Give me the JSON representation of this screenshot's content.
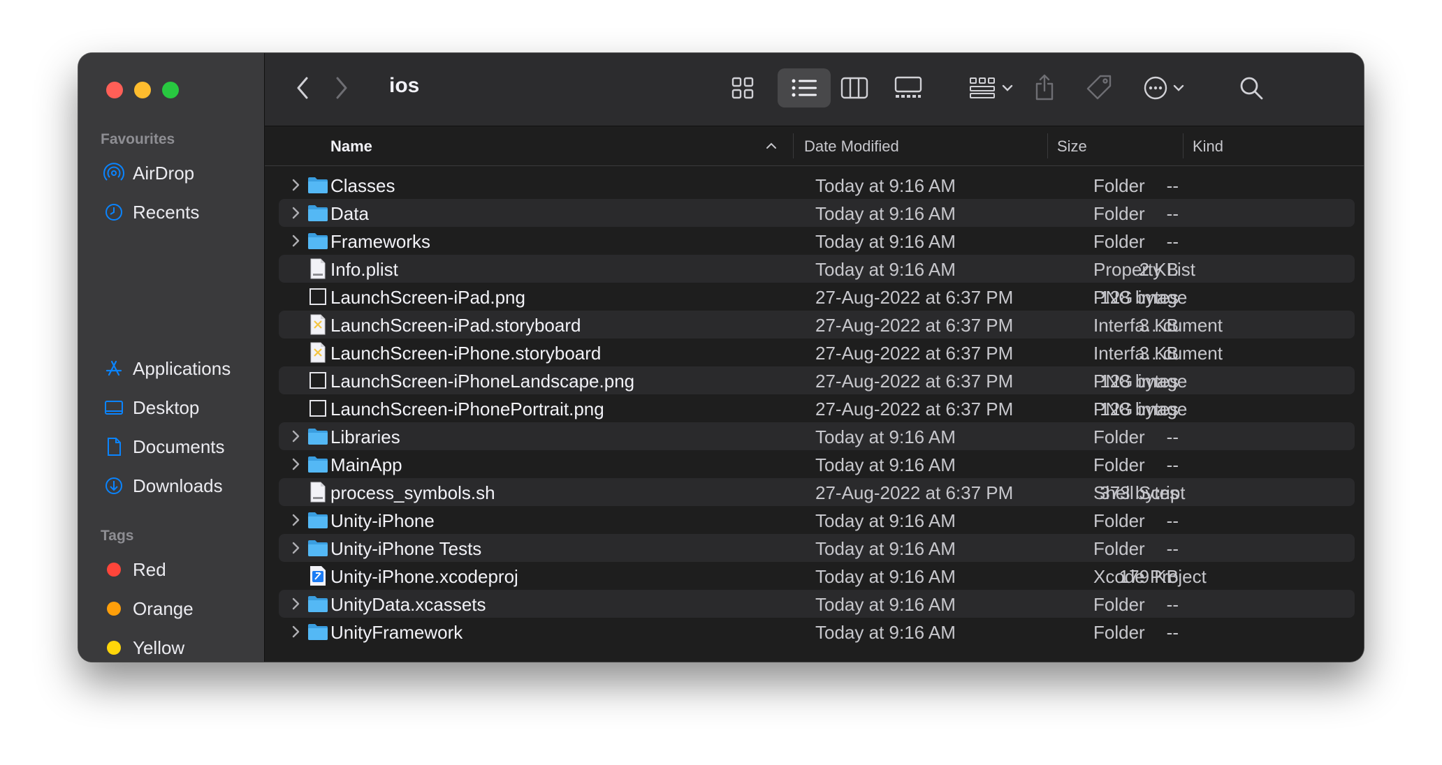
{
  "window": {
    "title": "ios",
    "colors": {
      "accent": "#0a84ff",
      "folder": "#54b8f5",
      "sidebar_bg": "#3a3a3c",
      "content_bg": "#1e1e1e"
    }
  },
  "sidebar": {
    "favourites_heading": "Favourites",
    "favourites": [
      {
        "label": "AirDrop",
        "icon": "airdrop-icon"
      },
      {
        "label": "Recents",
        "icon": "clock-icon"
      },
      {
        "label": "Applications",
        "icon": "applications-icon"
      },
      {
        "label": "Desktop",
        "icon": "desktop-icon"
      },
      {
        "label": "Documents",
        "icon": "document-icon"
      },
      {
        "label": "Downloads",
        "icon": "downloads-icon"
      }
    ],
    "tags_heading": "Tags",
    "tags": [
      {
        "label": "Red",
        "color": "#ff453a"
      },
      {
        "label": "Orange",
        "color": "#ff9f0a"
      },
      {
        "label": "Yellow",
        "color": "#ffd60a"
      }
    ]
  },
  "toolbar": {
    "icons": [
      "back-icon",
      "forward-icon",
      "icon-view-icon",
      "list-view-icon",
      "column-view-icon",
      "gallery-view-icon",
      "group-icon",
      "share-icon",
      "tag-icon",
      "more-icon",
      "search-icon"
    ]
  },
  "columns": {
    "name": "Name",
    "date": "Date Modified",
    "size": "Size",
    "kind": "Kind"
  },
  "files": [
    {
      "name": "Classes",
      "date": "Today at 9:16 AM",
      "size": "--",
      "kind": "Folder",
      "type": "folder"
    },
    {
      "name": "Data",
      "date": "Today at 9:16 AM",
      "size": "--",
      "kind": "Folder",
      "type": "folder"
    },
    {
      "name": "Frameworks",
      "date": "Today at 9:16 AM",
      "size": "--",
      "kind": "Folder",
      "type": "folder"
    },
    {
      "name": "Info.plist",
      "date": "Today at 9:16 AM",
      "size": "2 KB",
      "kind": "Property List",
      "type": "plist"
    },
    {
      "name": "LaunchScreen-iPad.png",
      "date": "27-Aug-2022 at 6:37 PM",
      "size": "128 bytes",
      "kind": "PNG image",
      "type": "png"
    },
    {
      "name": "LaunchScreen-iPad.storyboard",
      "date": "27-Aug-2022 at 6:37 PM",
      "size": "3 KB",
      "kind": "Interfa…cument",
      "type": "storyboard"
    },
    {
      "name": "LaunchScreen-iPhone.storyboard",
      "date": "27-Aug-2022 at 6:37 PM",
      "size": "3 KB",
      "kind": "Interfa…cument",
      "type": "storyboard"
    },
    {
      "name": "LaunchScreen-iPhoneLandscape.png",
      "date": "27-Aug-2022 at 6:37 PM",
      "size": "128 bytes",
      "kind": "PNG image",
      "type": "png"
    },
    {
      "name": "LaunchScreen-iPhonePortrait.png",
      "date": "27-Aug-2022 at 6:37 PM",
      "size": "128 bytes",
      "kind": "PNG image",
      "type": "png"
    },
    {
      "name": "Libraries",
      "date": "Today at 9:16 AM",
      "size": "--",
      "kind": "Folder",
      "type": "folder"
    },
    {
      "name": "MainApp",
      "date": "Today at 9:16 AM",
      "size": "--",
      "kind": "Folder",
      "type": "folder"
    },
    {
      "name": "process_symbols.sh",
      "date": "27-Aug-2022 at 6:37 PM",
      "size": "373 bytes",
      "kind": "Shell Script",
      "type": "shell"
    },
    {
      "name": "Unity-iPhone",
      "date": "Today at 9:16 AM",
      "size": "--",
      "kind": "Folder",
      "type": "folder"
    },
    {
      "name": "Unity-iPhone Tests",
      "date": "Today at 9:16 AM",
      "size": "--",
      "kind": "Folder",
      "type": "folder"
    },
    {
      "name": "Unity-iPhone.xcodeproj",
      "date": "Today at 9:16 AM",
      "size": "179 KB",
      "kind": "Xcode Project",
      "type": "xcodeproj"
    },
    {
      "name": "UnityData.xcassets",
      "date": "Today at 9:16 AM",
      "size": "--",
      "kind": "Folder",
      "type": "folder"
    },
    {
      "name": "UnityFramework",
      "date": "Today at 9:16 AM",
      "size": "--",
      "kind": "Folder",
      "type": "folder"
    }
  ]
}
